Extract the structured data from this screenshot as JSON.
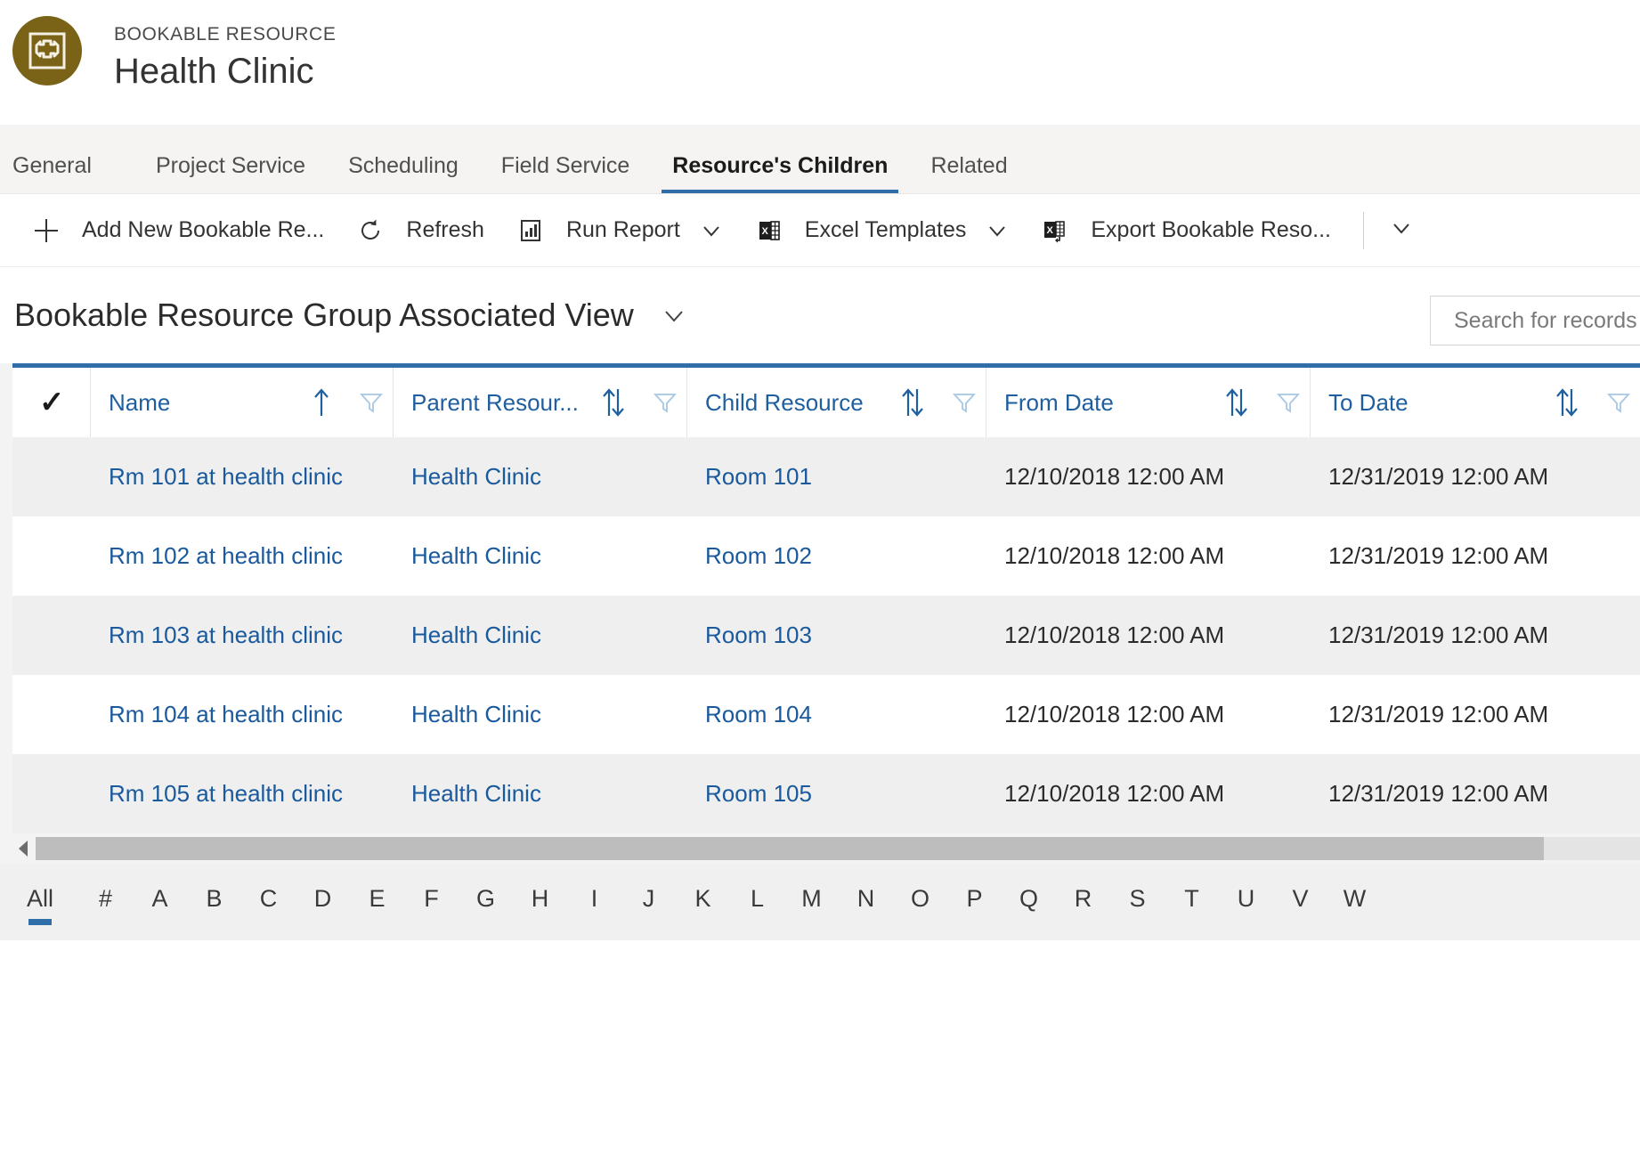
{
  "header": {
    "entity_type": "BOOKABLE RESOURCE",
    "record_title": "Health Clinic",
    "avatar_icon": "bookable-resource-icon",
    "avatar_color": "#7a6216"
  },
  "tabs": [
    {
      "label": "General",
      "active": false
    },
    {
      "label": "Project Service",
      "active": false
    },
    {
      "label": "Scheduling",
      "active": false
    },
    {
      "label": "Field Service",
      "active": false
    },
    {
      "label": "Resource's Children",
      "active": true
    },
    {
      "label": "Related",
      "active": false
    }
  ],
  "commandbar": {
    "items": [
      {
        "label": "Add New Bookable Re...",
        "icon": "plus-icon",
        "has_chevron": false
      },
      {
        "label": "Refresh",
        "icon": "refresh-icon",
        "has_chevron": false
      },
      {
        "label": "Run Report",
        "icon": "report-chart-icon",
        "has_chevron": true
      },
      {
        "label": "Excel Templates",
        "icon": "excel-icon",
        "has_chevron": true
      },
      {
        "label": "Export Bookable Reso...",
        "icon": "excel-export-icon",
        "has_chevron": false
      }
    ],
    "overflow_icon": "chevron-down-icon"
  },
  "view": {
    "title": "Bookable Resource Group Associated View",
    "selector_icon": "chevron-down-icon"
  },
  "search": {
    "placeholder": "Search for records",
    "value": ""
  },
  "grid": {
    "accent_color": "#2f6ea8",
    "link_color": "#19599c",
    "select_all_icon": "checkmark-icon",
    "columns": [
      {
        "label": "Name",
        "sort": "asc",
        "sort_icon": "sort-ascending-icon",
        "filter_icon": "filter-icon"
      },
      {
        "label": "Parent Resour...",
        "sort": "none",
        "sort_icon": "sort-icon",
        "filter_icon": "filter-icon"
      },
      {
        "label": "Child Resource",
        "sort": "none",
        "sort_icon": "sort-icon",
        "filter_icon": "filter-icon"
      },
      {
        "label": "From Date",
        "sort": "none",
        "sort_icon": "sort-icon",
        "filter_icon": "filter-icon"
      },
      {
        "label": "To Date",
        "sort": "none",
        "sort_icon": "sort-icon",
        "filter_icon": "filter-icon"
      }
    ],
    "rows": [
      {
        "name": "Rm 101 at health clinic",
        "parent": "Health Clinic",
        "child": "Room 101",
        "from": "12/10/2018 12:00 AM",
        "to": "12/31/2019 12:00 AM"
      },
      {
        "name": "Rm 102 at health clinic",
        "parent": "Health Clinic",
        "child": "Room 102",
        "from": "12/10/2018 12:00 AM",
        "to": "12/31/2019 12:00 AM"
      },
      {
        "name": "Rm 103 at health clinic",
        "parent": "Health Clinic",
        "child": "Room 103",
        "from": "12/10/2018 12:00 AM",
        "to": "12/31/2019 12:00 AM"
      },
      {
        "name": "Rm 104 at health clinic",
        "parent": "Health Clinic",
        "child": "Room 104",
        "from": "12/10/2018 12:00 AM",
        "to": "12/31/2019 12:00 AM"
      },
      {
        "name": "Rm 105 at health clinic",
        "parent": "Health Clinic",
        "child": "Room 105",
        "from": "12/10/2018 12:00 AM",
        "to": "12/31/2019 12:00 AM"
      }
    ]
  },
  "scrollbar": {
    "left_arrow_icon": "caret-left-icon"
  },
  "alphabet": {
    "all_label": "All",
    "active": "All",
    "letters": [
      "#",
      "A",
      "B",
      "C",
      "D",
      "E",
      "F",
      "G",
      "H",
      "I",
      "J",
      "K",
      "L",
      "M",
      "N",
      "O",
      "P",
      "Q",
      "R",
      "S",
      "T",
      "U",
      "V",
      "W"
    ]
  }
}
